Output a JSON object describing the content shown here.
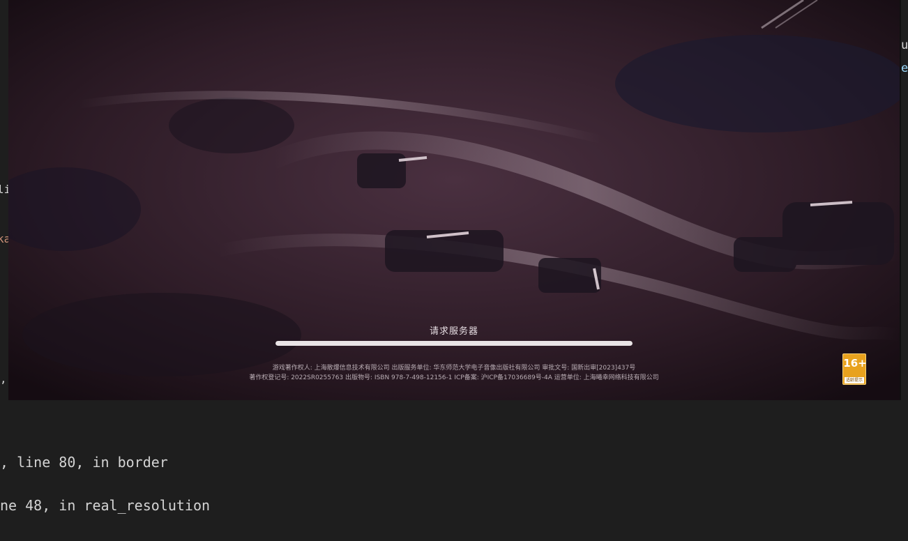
{
  "editor": {
    "edge_chars": {
      "top_right_1": "u",
      "top_right_2": "e",
      "left_1": "li",
      "left_2": "ka",
      "left_3": ","
    }
  },
  "terminal": {
    "lines": [
      ", line 80, in border",
      "ne 48, in real_resolution"
    ]
  },
  "game": {
    "loading_text": "请求服务器",
    "progress": 1.0,
    "copyright_line1": "游戏著作权人: 上海散爆信息技术有限公司  出版服务单位: 华东师范大学电子音像出版社有限公司  审批文号: 国新出审[2023]437号",
    "copyright_line2": "著作权登记号: 2022SR0255763 出版物号: ISBN 978-7-498-12156-1 ICP备案: 沪ICP备17036689号-4A 运营单位: 上海曦幸网络科技有限公司",
    "age_rating": {
      "number": "16+",
      "label": "适龄提示"
    }
  },
  "colors": {
    "editor_bg": "#1e1e1e",
    "scene_tint": "#2a1a22",
    "progress_fill": "#e9e4e6",
    "age_badge": "#e8a21e"
  }
}
